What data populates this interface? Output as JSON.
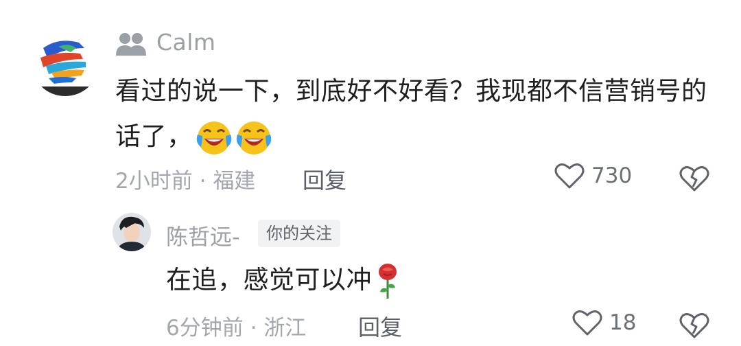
{
  "comment": {
    "username": "Calm",
    "text": "看过的说一下，到底好不好看？我现都不信营销号的话了，",
    "emojis": [
      "laughing-crying-emoji",
      "laughing-crying-emoji"
    ],
    "time": "2小时前",
    "separator": "·",
    "location": "福建",
    "reply_label": "回复",
    "likes": "730",
    "colors": {
      "text": "#1f1f1f",
      "meta": "#a3a7ad",
      "username": "#9aa0a6"
    }
  },
  "reply": {
    "username": "陈哲远-",
    "badge": "你的关注",
    "text": "在追，感觉可以冲",
    "emoji": "rose-emoji",
    "time": "6分钟前",
    "separator": "·",
    "location": "浙江",
    "reply_label": "回复",
    "likes": "18"
  }
}
